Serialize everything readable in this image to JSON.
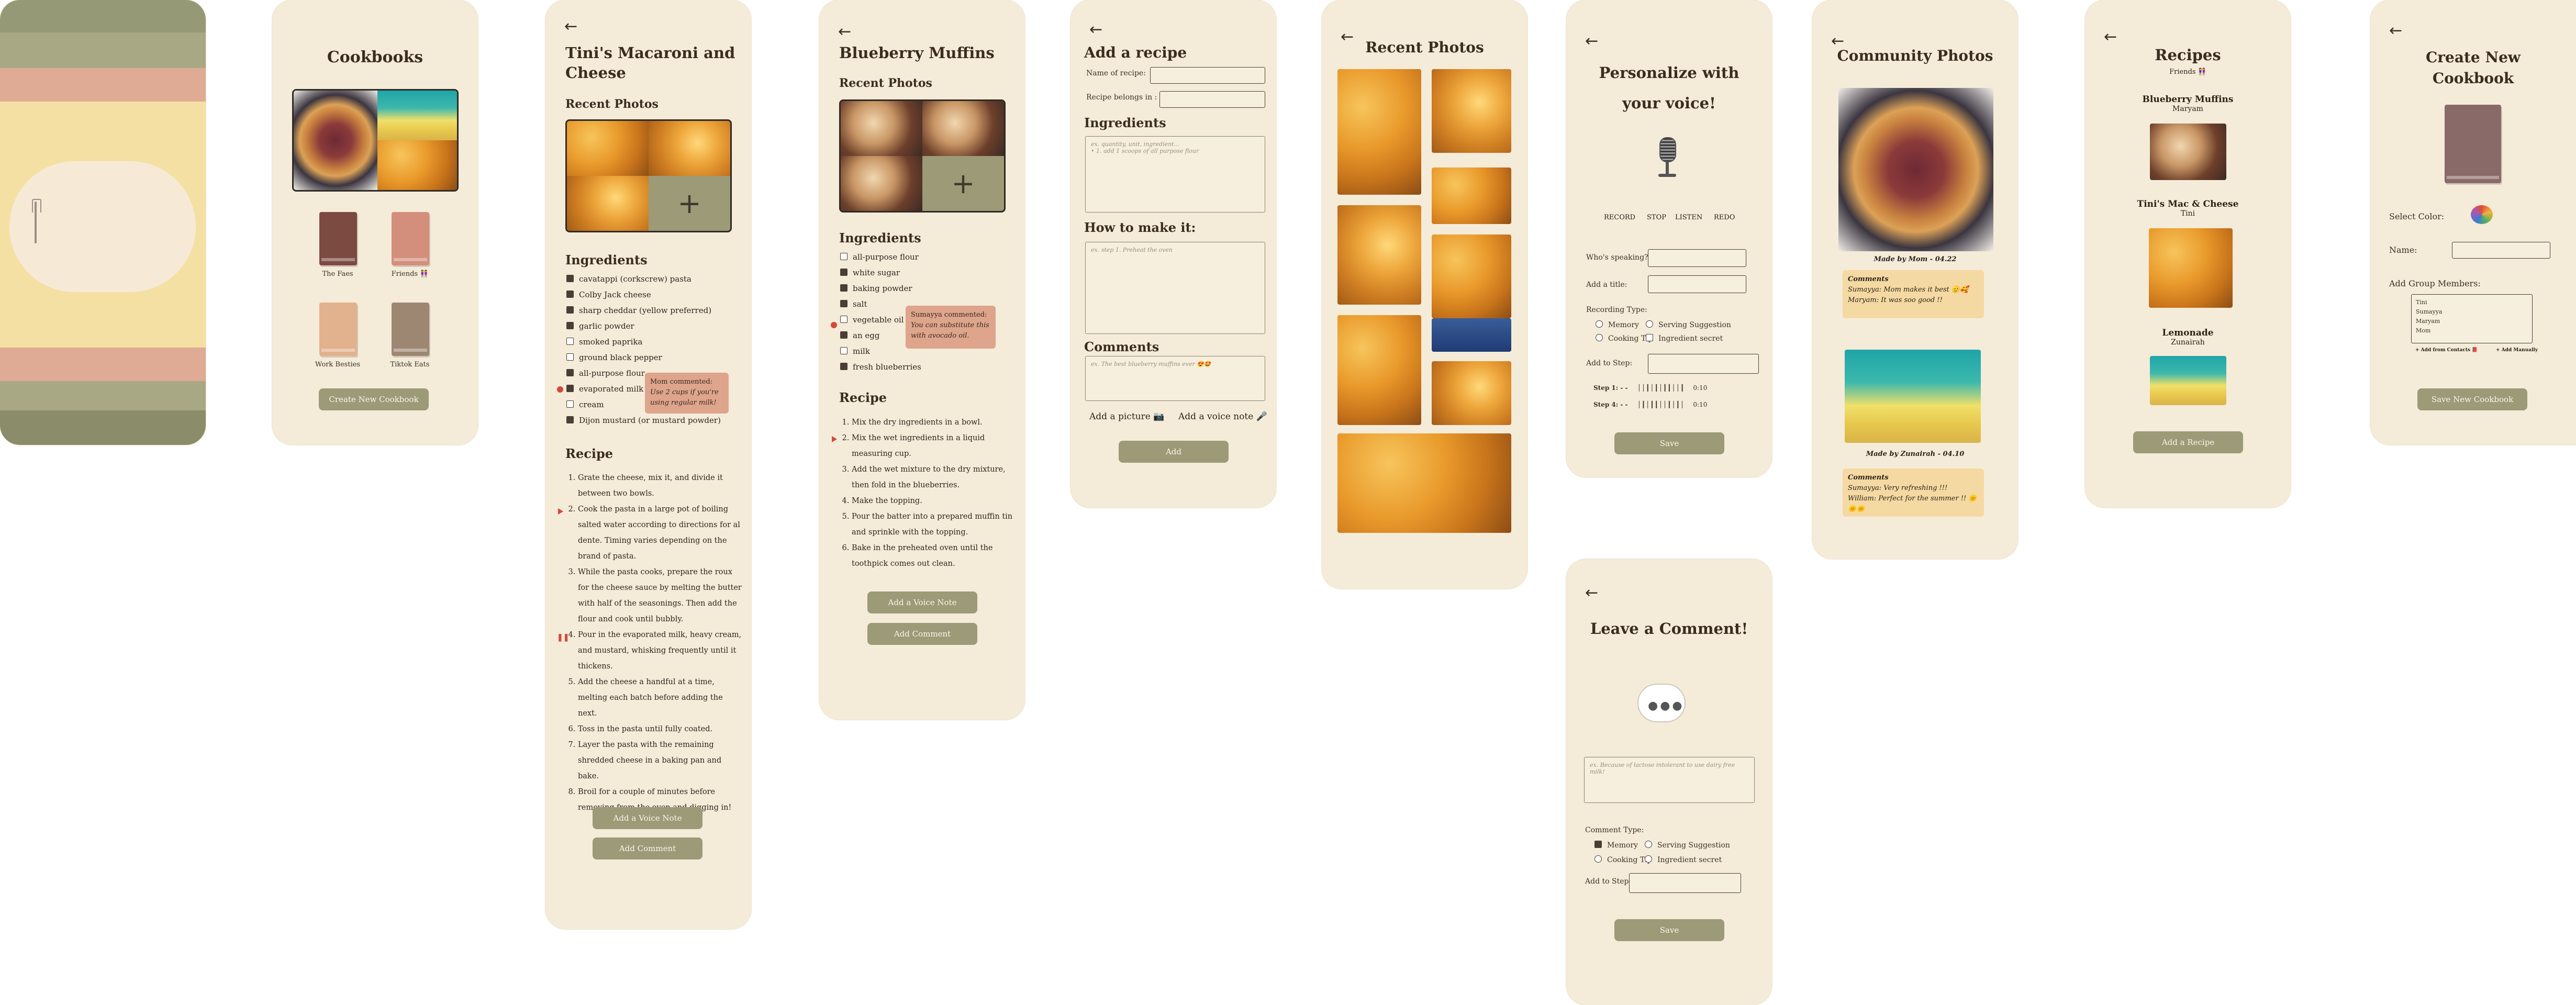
{
  "splash": {},
  "cookbooks": {
    "title": "Cookbooks",
    "books": [
      {
        "label": "The Faes",
        "color": "#7d4a41"
      },
      {
        "label": "Friends 👭",
        "color": "#d48e7c"
      },
      {
        "label": "Work Besties",
        "color": "#e2b18d"
      },
      {
        "label": "Tiktok Eats",
        "color": "#9e8772"
      }
    ],
    "create_button": "Create New Cookbook"
  },
  "mac": {
    "title_line1": "Tini's Macaroni and",
    "title_line2": "Cheese",
    "recent_photos": "Recent Photos",
    "ingredients_heading": "Ingredients",
    "ingredients": [
      {
        "text": "cavatappi (corkscrew) pasta",
        "checked": true
      },
      {
        "text": "Colby Jack cheese",
        "checked": true
      },
      {
        "text": "sharp cheddar (yellow preferred)",
        "checked": true
      },
      {
        "text": "garlic powder",
        "checked": true
      },
      {
        "text": "smoked paprika",
        "checked": false
      },
      {
        "text": "ground black pepper",
        "checked": false
      },
      {
        "text": "all-purpose flour",
        "checked": true
      },
      {
        "text": "evaporated milk",
        "checked": true
      },
      {
        "text": "cream",
        "checked": false
      },
      {
        "text": "Dijon mustard (or mustard powder)",
        "checked": true
      }
    ],
    "comment_title": "Mom commented:",
    "comment_text": "Use 2 cups if you're using regular milk!",
    "recipe_heading": "Recipe",
    "steps": [
      "Grate the cheese, mix it, and divide it between two bowls.",
      "Cook the pasta in a large pot of boiling salted water according to directions for al dente. Timing varies depending on the brand of pasta.",
      "While the pasta cooks, prepare the roux for the cheese sauce by melting the butter with half of the seasonings. Then add the flour and cook until bubbly.",
      "Pour in the evaporated milk, heavy cream, and mustard, whisking frequently until it thickens.",
      "Add the cheese a handful at a time, melting each batch before adding the next.",
      "Toss in the pasta until fully coated.",
      "Layer the pasta with the remaining shredded cheese in a baking pan and bake.",
      "Broil for a couple of minutes before removing from the oven and digging in!"
    ],
    "voice_button": "Add a Voice Note",
    "comment_button": "Add Comment"
  },
  "muffins": {
    "title": "Blueberry Muffins",
    "recent_photos": "Recent Photos",
    "ingredients_heading": "Ingredients",
    "ingredients": [
      {
        "text": "all-purpose flour",
        "checked": false
      },
      {
        "text": "white sugar",
        "checked": true
      },
      {
        "text": "baking powder",
        "checked": true
      },
      {
        "text": "salt",
        "checked": true
      },
      {
        "text": "vegetable oil",
        "checked": false
      },
      {
        "text": "an egg",
        "checked": true
      },
      {
        "text": "milk",
        "checked": false
      },
      {
        "text": "fresh blueberries",
        "checked": true
      }
    ],
    "comment_title": "Sumayya commented:",
    "comment_text": "You can substitute this with avocado oil.",
    "recipe_heading": "Recipe",
    "steps": [
      "Mix the dry ingredients in a bowl.",
      "Mix the wet ingredients in a liquid measuring cup.",
      "Add the wet mixture to the dry mixture, then fold in the blueberries.",
      "Make the topping.",
      "Pour the batter into a prepared muffin tin and sprinkle with the topping.",
      "Bake in the preheated oven until the toothpick comes out clean."
    ],
    "voice_button": "Add a Voice Note",
    "comment_button": "Add Comment"
  },
  "add_recipe": {
    "title": "Add a recipe",
    "name_label": "Name of recipe:",
    "belongs_label": "Recipe belongs in :",
    "ingredients_heading": "Ingredients",
    "ingredients_placeholder": "ex. quantity, unit, ingredient...\n  • 1. add 1 scoops of all purpose flour",
    "howto_heading": "How to make it:",
    "howto_placeholder": "ex. step 1. Preheat the oven",
    "comments_heading": "Comments",
    "comments_placeholder": "ex. The best blueberry muffins ever 😍🤩",
    "add_picture": "Add a picture 📷",
    "add_voice": "Add a voice note 🎤",
    "add_button": "Add"
  },
  "recent_photos": {
    "title": "Recent Photos"
  },
  "voice": {
    "title_line1": "Personalize with",
    "title_line2": "your voice!",
    "controls": [
      "RECORD",
      "STOP",
      "LISTEN",
      "REDO"
    ],
    "speaking_label": "Who's speaking?",
    "title_label": "Add a title:",
    "type_label": "Recording Type:",
    "types": [
      "Memory",
      "Serving Suggestion",
      "Cooking Tip",
      "Ingredient secret"
    ],
    "step_label": "Add to Step:",
    "rec1_label": "Step 1: - -",
    "rec1_time": "0:10",
    "rec2_label": "Step 4: - -",
    "rec2_time": "0:10",
    "save_button": "Save"
  },
  "leave_comment": {
    "title": "Leave a Comment!",
    "placeholder": "ex. Because of lactose intolerant to use dairy free milk!",
    "type_label": "Comment Type:",
    "types": [
      "Memory",
      "Serving Suggestion",
      "Cooking Tip",
      "Ingredient secret"
    ],
    "step_label": "Add to Step:",
    "save_button": "Save"
  },
  "community": {
    "title": "Community Photos",
    "caption1": "Made by Mom - 04.22",
    "comments_heading": "Comments",
    "c1a": "Sumayya: Mom makes it best 🫡🥰",
    "c1b": "Maryam: It was soo good !!",
    "caption2": "Made by Zunairah - 04.10",
    "comments_heading2": "Comments",
    "c2a": "Sumayya: Very refreshing !!!",
    "c2b": "William: Perfect for the summer !! 🌞🌞🌞"
  },
  "recipes": {
    "title": "Recipes",
    "subtitle": "Friends 👭",
    "items": [
      {
        "name": "Blueberry Muffins",
        "author": "Maryam"
      },
      {
        "name": "Tini's Mac & Cheese",
        "author": "Tini"
      },
      {
        "name": "Lemonade",
        "author": "Zunairah"
      }
    ],
    "add_button": "Add a Recipe"
  },
  "create_cookbook": {
    "title_line1": "Create New",
    "title_line2": "Cookbook",
    "color_label": "Select Color:",
    "name_label": "Name:",
    "members_label": "Add Group Members:",
    "members": [
      "Tini",
      "Sumayya",
      "Maryam",
      "Mom"
    ],
    "add_contacts": "+ Add from Contacts 📕",
    "add_manually": "+ Add Manually",
    "save_button": "Save New Cookbook"
  }
}
